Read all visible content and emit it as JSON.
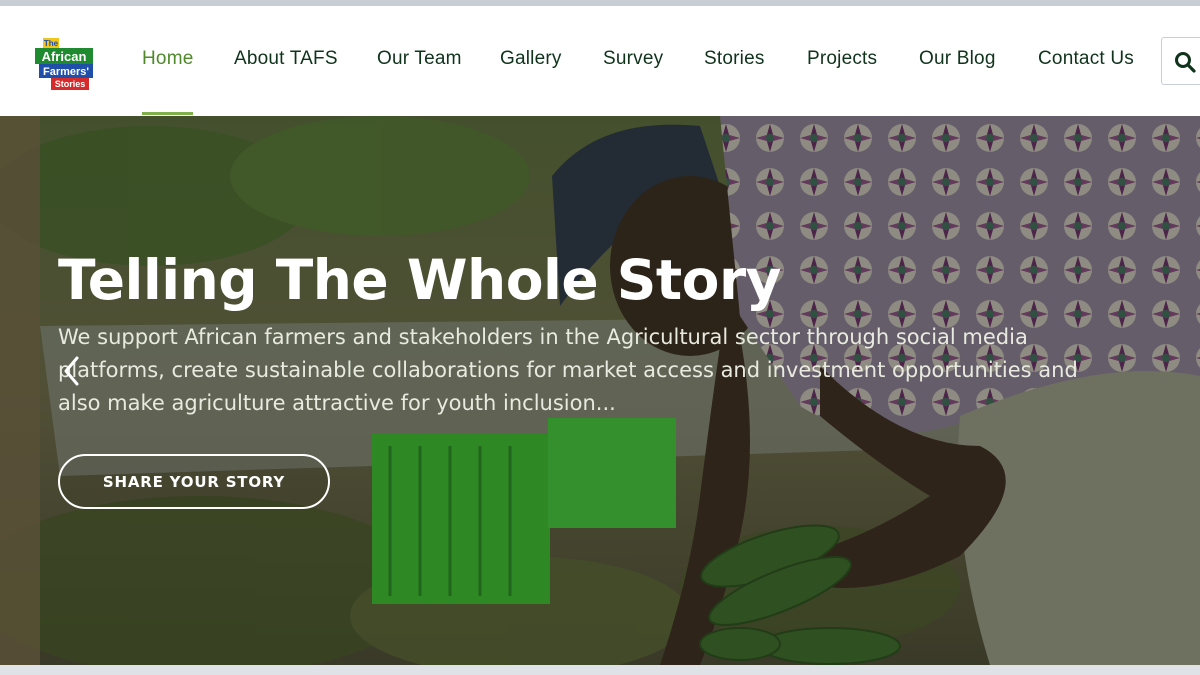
{
  "brand": {
    "logo_lines": [
      "The",
      "African",
      "Farmers'",
      "Stories"
    ],
    "colors": {
      "green": "#1f8a2f",
      "red": "#d72b2b",
      "yellow": "#f2c51b",
      "blue": "#1f4fa8"
    }
  },
  "nav": {
    "items": [
      {
        "label": "Home",
        "active": true
      },
      {
        "label": "About TAFS",
        "active": false
      },
      {
        "label": "Our Team",
        "active": false
      },
      {
        "label": "Gallery",
        "active": false
      },
      {
        "label": "Survey",
        "active": false
      },
      {
        "label": "Stories",
        "active": false
      },
      {
        "label": "Projects",
        "active": false
      },
      {
        "label": "Our Blog",
        "active": false
      },
      {
        "label": "Contact Us",
        "active": false
      }
    ],
    "search_icon": "search-icon",
    "accent_color": "#4f8a2a",
    "text_color": "#10331c"
  },
  "hero": {
    "title": "Telling The Whole Story",
    "lines": [
      "We support African farmers and stakeholders in the Agricultural sector through social media",
      "platforms, create sustainable collaborations for market access and investment opportunities and",
      "also make agriculture attractive for youth inclusion..."
    ],
    "cta_label": "SHARE YOUR STORY",
    "prev_icon": "chevron-left-icon"
  }
}
